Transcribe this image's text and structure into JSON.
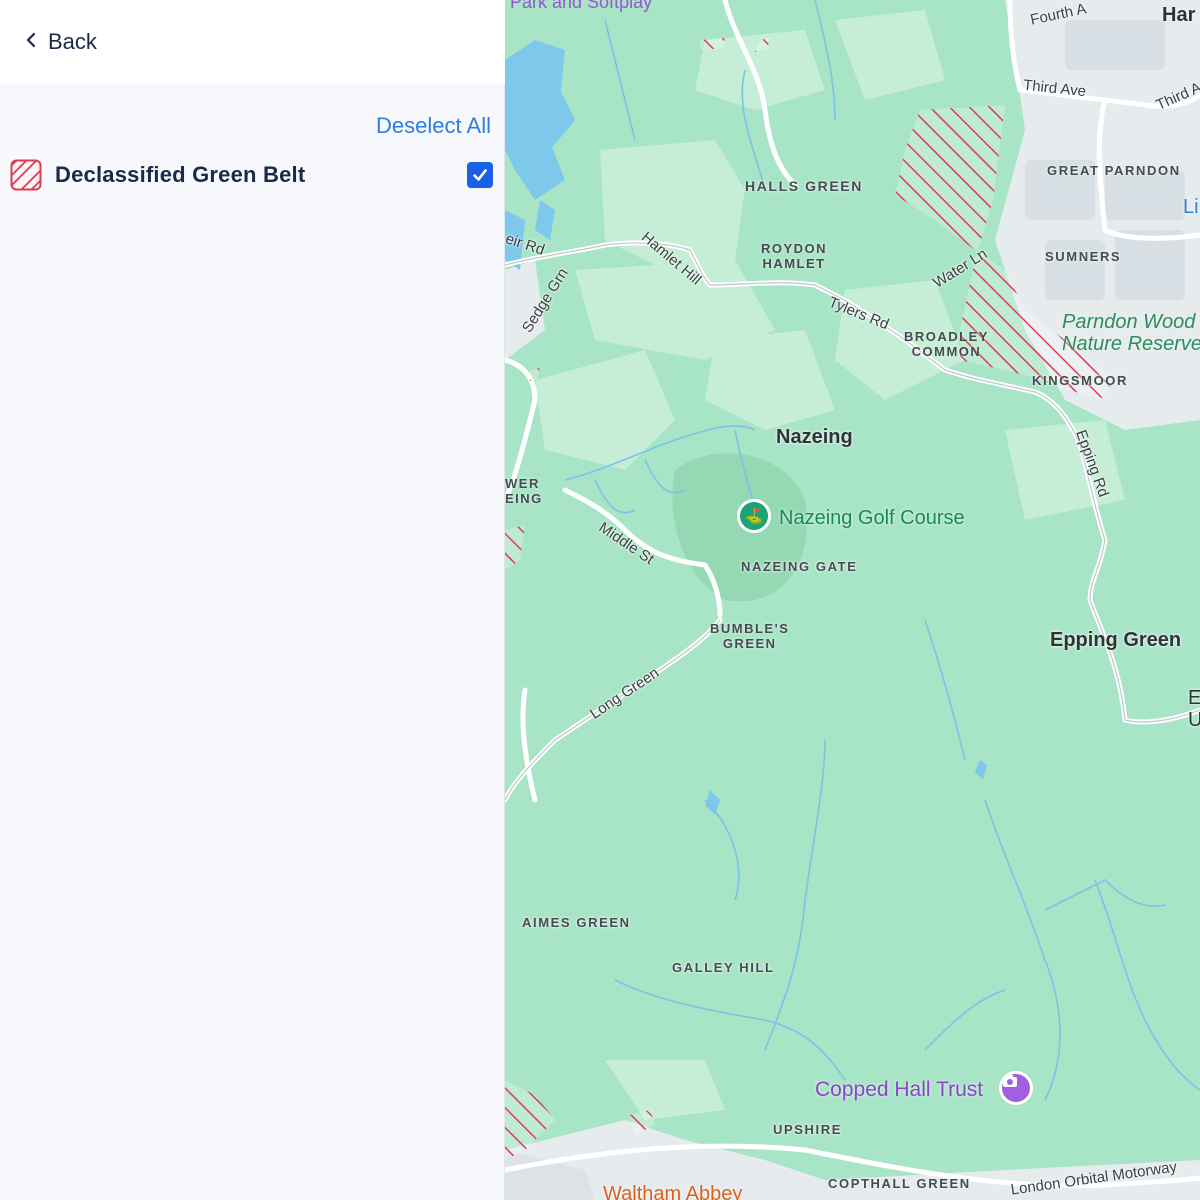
{
  "panel": {
    "back_label": "Back",
    "deselect_all_label": "Deselect All",
    "layers": [
      {
        "label": "Declassified Green Belt",
        "checked": true,
        "color": "#e03a52",
        "icon": "diagonal-hatch-swatch-icon"
      }
    ]
  },
  "map": {
    "places": {
      "halls_green": "HALLS GREEN",
      "roydon_hamlet_1": "ROYDON",
      "roydon_hamlet_2": "HAMLET",
      "broadley_1": "BROADLEY",
      "broadley_2": "COMMON",
      "great_parndon": "GREAT PARNDON",
      "sumners": "SUMNERS",
      "kingsmoor": "KINGSMOOR",
      "nazeing": "Nazeing",
      "nazeing_gate": "NAZEING GATE",
      "bumbles_1": "BUMBLE'S",
      "bumbles_2": "GREEN",
      "epping_green": "Epping Green",
      "aimes_green": "AIMES GREEN",
      "galley_hill": "GALLEY HILL",
      "upshire": "UPSHIRE",
      "copthall_green": "COPTHALL GREEN",
      "lower_1": "WER",
      "lower_2": "EING",
      "harlow_partial": "Har",
      "right_edge_1": "E",
      "right_edge_2": "U",
      "right_edge_3": "Li"
    },
    "roads": {
      "weir_rd": "eir Rd",
      "sedge_grn": "Sedge Grn",
      "hamlet_hill": "Hamlet Hill",
      "tylers_rd": "Tylers Rd",
      "water_ln": "Water Ln",
      "epping_rd": "Epping Rd",
      "middle_st": "Middle St",
      "long_green": "Long Green",
      "third_ave": "Third Ave",
      "third_ave_2": "Third A",
      "fourth_ave": "Fourth A",
      "motorway": "London Orbital Motorway"
    },
    "pois": {
      "golf": "Nazeing Golf Course",
      "golf_icon": "golf-flag-icon",
      "parndon_1": "Parndon Wood",
      "parndon_2": "Nature Reserve",
      "copped_hall": "Copped Hall Trust",
      "copped_icon": "camera-icon",
      "waltham_abbey": "Waltham Abbey",
      "park_top": "Park and Softplay"
    },
    "colors": {
      "land": "#a8e4c6",
      "water": "#7ec8ec",
      "urban": "#e9edf0",
      "hatch": "#e03a52"
    }
  }
}
